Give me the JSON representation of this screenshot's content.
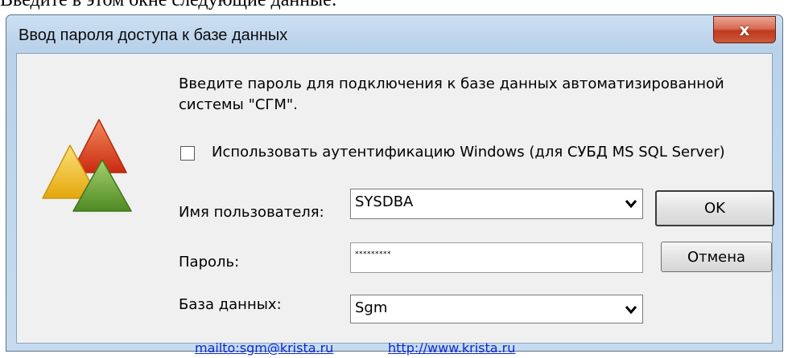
{
  "document": {
    "caption": "Введите в этом окне следующие данные:"
  },
  "window": {
    "title": "Ввод пароля доступа к базе данных",
    "close_label": "x"
  },
  "dialog": {
    "intro_line1": "Введите пароль для подключения к базе данных автоматизированной",
    "intro_line2": "системы \"СГМ\".",
    "windows_auth": {
      "label": "Использовать аутентификацию Windows (для СУБД MS SQL Server)",
      "checked": false
    },
    "username": {
      "label": "Имя пользователя:",
      "value": "SYSDBA"
    },
    "password": {
      "label": "Пароль:",
      "value": "*********"
    },
    "database": {
      "label": "База данных:",
      "value": "Sgm"
    },
    "buttons": {
      "ok": "OK",
      "cancel": "Отмена"
    },
    "links": {
      "mail": "mailto:sgm@krista.ru",
      "web": "http://www.krista.ru"
    }
  },
  "icons": {
    "logo": "triangles-logo-icon",
    "dropdown": "chevron-down-icon",
    "close": "close-icon"
  },
  "colors": {
    "title_bg": "#c4d9ee",
    "close_button": "#c94b2f",
    "link": "#0b2bd0",
    "logo_red": "#e0381a",
    "logo_yellow": "#f4c21a",
    "logo_green": "#6aa332"
  }
}
